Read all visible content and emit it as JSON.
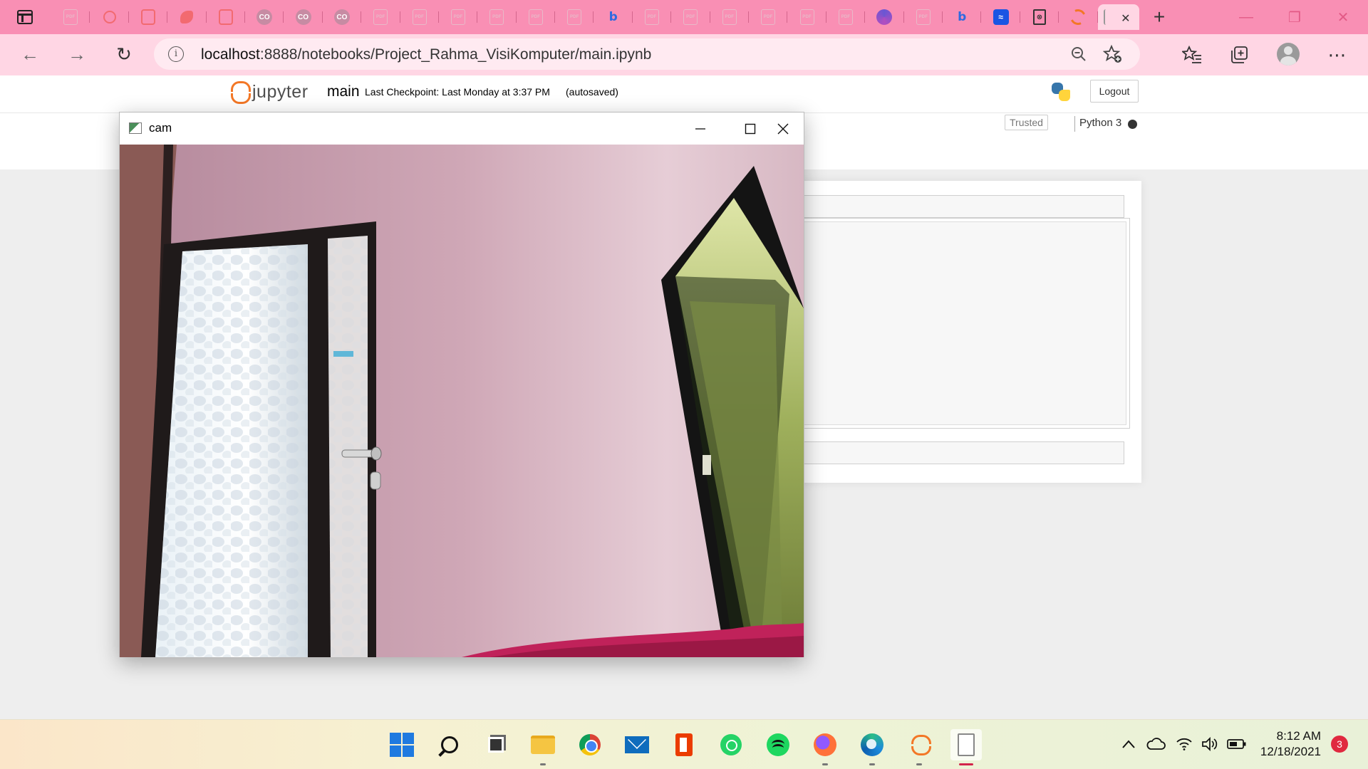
{
  "browser": {
    "tabs": [
      {
        "icon": "pdf-icon",
        "label": "PDF"
      },
      {
        "icon": "ring-app-icon",
        "label": ""
      },
      {
        "icon": "square-app-icon",
        "label": ""
      },
      {
        "icon": "leaf-app-icon",
        "label": ""
      },
      {
        "icon": "square-app-icon",
        "label": ""
      },
      {
        "icon": "colab-icon",
        "label": "CO"
      },
      {
        "icon": "colab-icon",
        "label": "CO"
      },
      {
        "icon": "colab-icon",
        "label": "CO"
      },
      {
        "icon": "pdf-icon",
        "label": "PDF"
      },
      {
        "icon": "pdf-icon",
        "label": "PDF"
      },
      {
        "icon": "pdf-icon",
        "label": "PDF"
      },
      {
        "icon": "pdf-icon",
        "label": "PDF"
      },
      {
        "icon": "pdf-icon",
        "label": "PDF"
      },
      {
        "icon": "pdf-icon",
        "label": "PDF"
      },
      {
        "icon": "bing-icon",
        "label": "b"
      },
      {
        "icon": "pdf-icon",
        "label": "PDF"
      },
      {
        "icon": "pdf-icon",
        "label": "PDF"
      },
      {
        "icon": "pdf-icon",
        "label": "PDF"
      },
      {
        "icon": "pdf-icon",
        "label": "PDF"
      },
      {
        "icon": "pdf-icon",
        "label": "PDF"
      },
      {
        "icon": "pdf-icon",
        "label": "PDF"
      },
      {
        "icon": "edge-icon",
        "label": ""
      },
      {
        "icon": "pdf-icon",
        "label": "PDF"
      },
      {
        "icon": "bing-icon",
        "label": "b"
      },
      {
        "icon": "wave-app-icon",
        "label": "≈"
      },
      {
        "icon": "doc-icon",
        "label": "⊗"
      },
      {
        "icon": "jupyter-icon",
        "label": ""
      }
    ],
    "active_tab_index": 27,
    "new_tab_glyph": "+",
    "url": {
      "host": "localhost",
      "rest": ":8888/notebooks/Project_Rahma_VisiKomputer/main.ipynb"
    },
    "window_controls": {
      "minimize": "—",
      "restore": "❐",
      "close": "✕"
    }
  },
  "jupyter": {
    "logo_text": "jupyter",
    "notebook_name": "main",
    "checkpoint_text": "Last Checkpoint: Last Monday at 3:37 PM",
    "autosave_text": "(autosaved)",
    "logout_label": "Logout",
    "trusted_label": "Trusted",
    "kernel_name": "Python 3"
  },
  "cam_window": {
    "title": "cam",
    "controls": {
      "minimize": "—",
      "maximize": "☐",
      "close": "✕"
    }
  },
  "taskbar": {
    "apps": [
      "start",
      "search",
      "task-view",
      "file-explorer",
      "chrome",
      "mail",
      "office",
      "whatsapp",
      "spotify",
      "firefox",
      "edge",
      "jupyter",
      "notepad-file"
    ],
    "clock_time": "8:12 AM",
    "clock_date": "12/18/2021",
    "notification_count": "3"
  },
  "colors": {
    "browser_accent": "#f98fb4",
    "address_bar_bg": "#ffd6e4",
    "jupyter_orange": "#f37726",
    "notification_red": "#e0293f"
  }
}
